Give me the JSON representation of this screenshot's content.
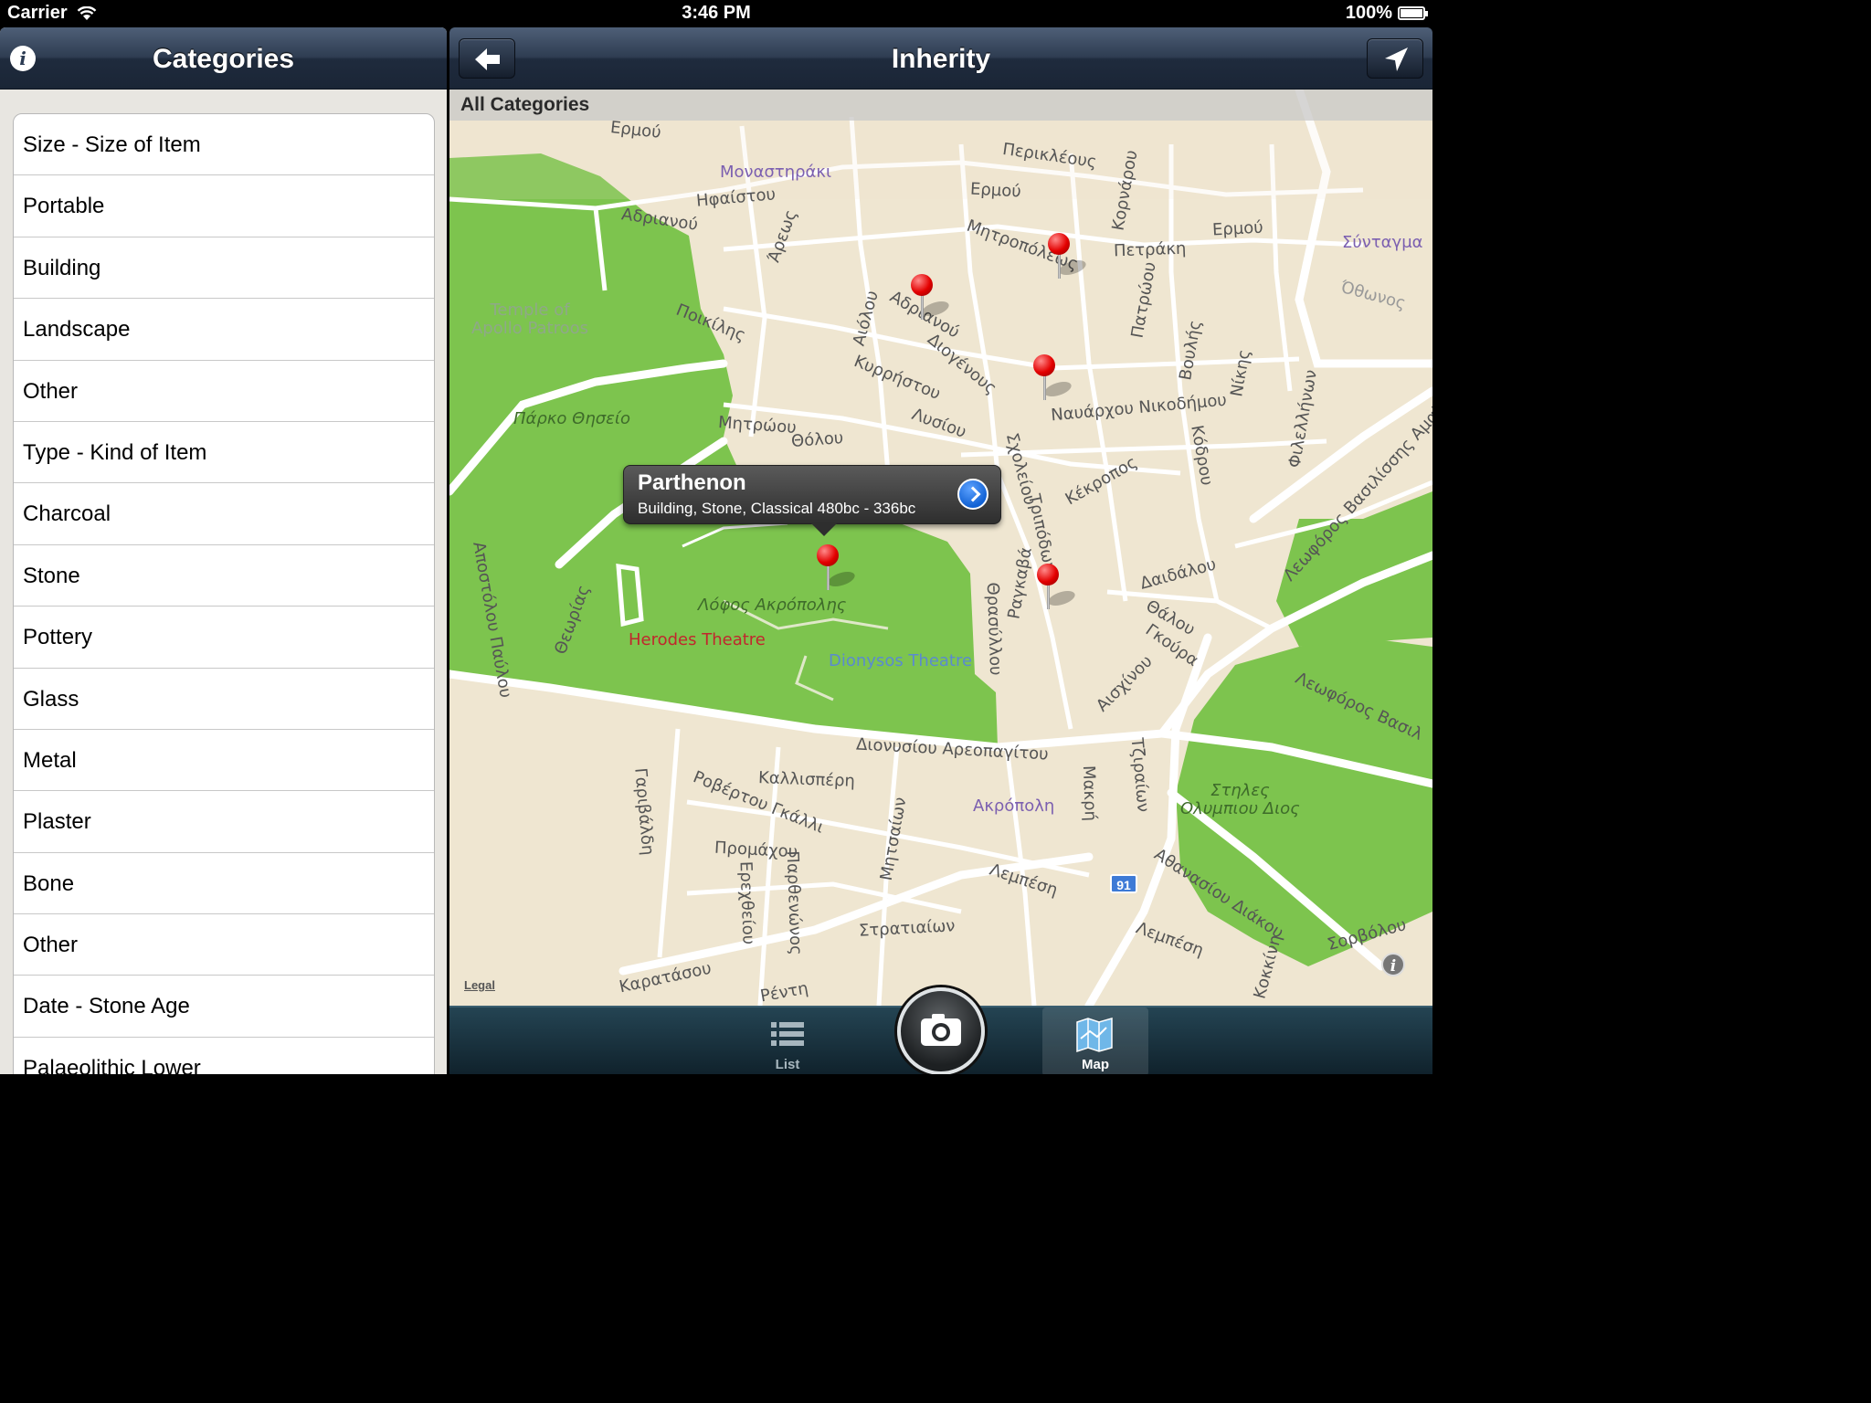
{
  "status_bar": {
    "carrier": "Carrier",
    "time": "3:46 PM",
    "battery": "100%",
    "battery_level": 1.0
  },
  "left_panel": {
    "title": "Categories",
    "rows": [
      "Size - Size of Item",
      "Portable",
      "Building",
      "Landscape",
      "Other",
      "Type - Kind of Item",
      "Charcoal",
      "Stone",
      "Pottery",
      "Glass",
      "Metal",
      "Plaster",
      "Bone",
      "Other",
      "Date - Stone Age",
      "Palaeolithic Lower"
    ]
  },
  "right_panel": {
    "title": "Inherity",
    "filter_label": "All Categories"
  },
  "map": {
    "callout": {
      "title": "Parthenon",
      "subtitle": "Building, Stone, Classical 480bc - 336bc"
    },
    "legal": "Legal",
    "route_shield": "91",
    "places": {
      "monastiraki": "Μοναστηράκι",
      "syntagma": "Σύνταγμα",
      "temple_apollo": "Temple of\nApollo Patroos",
      "thiseio_park": "Πάρκο Θησείο",
      "acropolis_hill": "Λόφος Ακρόπολης",
      "herodes": "Herodes Theatre",
      "dionysos": "Dionysos Theatre",
      "akropoli": "Ακρόπολη",
      "olympiou": "Στηλες\nΟλυμπιου Διος"
    },
    "streets": {
      "ermou_1": "Ερμού",
      "ermou_2": "Ερμού",
      "ermou_3": "Ερμού",
      "periklous": "Περικλέους",
      "ifaistou": "Ηφαίστου",
      "adrianou_1": "Αδριανού",
      "adrianou_2": "Αδριανού",
      "areos": "Άρεως",
      "mitropoleos": "Μητροπόλεως",
      "petraki": "Πετράκη",
      "poikilis": "Ποικίλης",
      "aiolou": "Αιόλου",
      "diogenous": "Διογένους",
      "kyrristou": "Κυρρήστου",
      "lysiou": "Λυσίου",
      "navarxou": "Ναυάρχου Νικοδήμου",
      "mitroou": "Μητρώου",
      "tholou": "Θόλου",
      "kekropos": "Κέκροπος",
      "daidalou": "Δαιδάλου",
      "thalou": "Θάλου",
      "gkoura": "Γκούρα",
      "aischinou": "Αισχίνου",
      "apostolou": "Αποστόλου Παύλου",
      "theorias": "Θεωρίας",
      "dionysiou": "Διονυσίου Αρεοπαγίτου",
      "kallisperi": "Καλλισπέρη",
      "robertou": "Ροβέρτου Γκάλλι",
      "promachou": "Προμάχου",
      "garivaldi": "Γαριβάλδη",
      "lempesi_1": "Λεμπέση",
      "lempesi_2": "Λεμπέση",
      "stratiaion": "Στρατιαίων",
      "karatasou": "Καρατάσου",
      "athanasiou": "Αθανασίου Διάκου",
      "vasilissis": "Λεωφόρος Βασιλίσσης Αμαλίας",
      "vasilissis_2": "Λεωφόρος Βασιλ",
      "makri": "Μακρή",
      "tzireon": "Τζιραίων",
      "mitsaion": "Μητσαίων",
      "thrasyllou": "Θρασύλλου",
      "tripodon": "Τριπόδων",
      "ragkava": "Ραγκαβά",
      "scholeiou": "Σχολείου",
      "vouleos": "Βουλής",
      "nikis": "Νίκης",
      "filellinon": "Φιλελλήνων",
      "kodrou": "Κόδρου",
      "kornarou": "Κορνάρου",
      "patroou": "Πατρώου",
      "othonos": "Όθωνος",
      "sorvolou": "Σορβόλου",
      "erechtheiou": "Ερεχθείου",
      "parthenonos": "Παρθενώνος",
      "renti": "Ρέντη",
      "kokkini": "Κοκκίνη"
    }
  },
  "tab_bar": {
    "tabs": [
      {
        "label": "List",
        "selected": false
      },
      {
        "label": "Map",
        "selected": true
      }
    ]
  },
  "colors": {
    "nav_dark": "#1f2b3d",
    "park_green": "#7dc44e",
    "map_bg": "#efe6d1",
    "pin_red": "#e30000",
    "tab_bar": "#10222c"
  }
}
